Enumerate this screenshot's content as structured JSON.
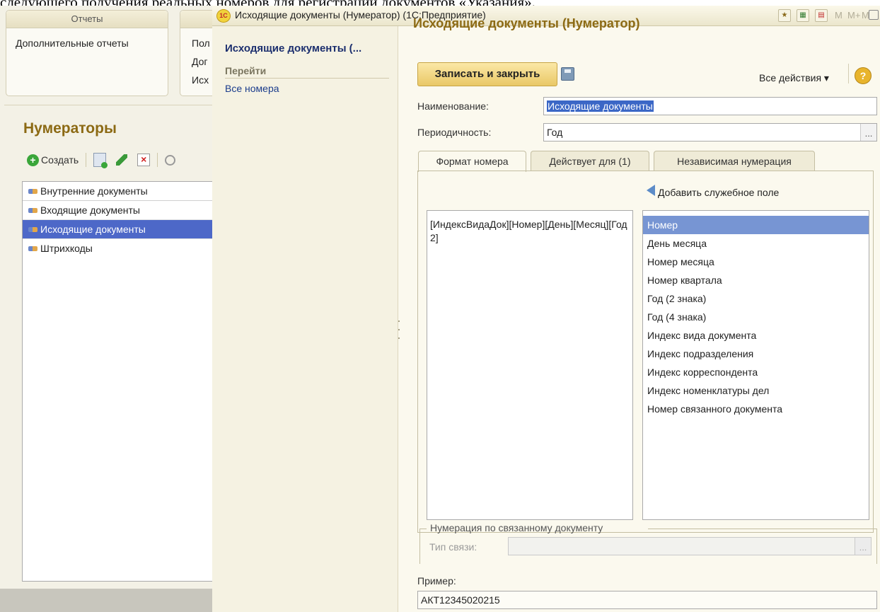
{
  "background_text": "следующего получения реальных номеров для регистрации документов «Указания».",
  "bg_app": {
    "reports_panel": {
      "title": "Отчеты",
      "link": "Дополнительные отчеты"
    },
    "second_panel_links": [
      "Пол",
      "Дог",
      "Исх"
    ],
    "section_title": "Нумераторы",
    "create_button": "Создать",
    "list_items": [
      "Внутренние документы",
      "Входящие документы",
      "Исходящие документы",
      "Штрихкоды"
    ],
    "selected_index": 2
  },
  "window": {
    "title": "Исходящие документы (Нумератор)  (1С:Предприятие)",
    "logo_text": "1С",
    "toolbar_m": [
      "M",
      "M+",
      "M-"
    ]
  },
  "nav": {
    "title": "Исходящие документы (...",
    "group": "Перейти",
    "link": "Все номера"
  },
  "form": {
    "title": "Исходящие документы (Нумератор)",
    "save_close": "Записать и закрыть",
    "all_actions": "Все действия ▾",
    "help": "?",
    "name_label": "Наименование:",
    "name_value": "Исходящие документы",
    "period_label": "Периодичность:",
    "period_value": "Год",
    "dots": "...",
    "tabs": [
      "Формат номера",
      "Действует для (1)",
      "Независимая нумерация"
    ],
    "add_field": "Добавить служебное поле",
    "format_value": "[ИндексВидаДок][Номер][День][Месяц][Год2]",
    "fields": [
      "Номер",
      "День месяца",
      "Номер месяца",
      "Номер квартала",
      "Год (2 знака)",
      "Год (4 знака)",
      "Индекс вида документа",
      "Индекс подразделения",
      "Индекс корреспондента",
      "Индекс номенклатуры дел",
      "Номер связанного документа"
    ],
    "selected_field": 0,
    "related_group": "Нумерация по связанному документу",
    "link_type_label": "Тип связи:",
    "link_type_value": "",
    "example_label": "Пример:",
    "example_value": "АКТ12345020215"
  }
}
